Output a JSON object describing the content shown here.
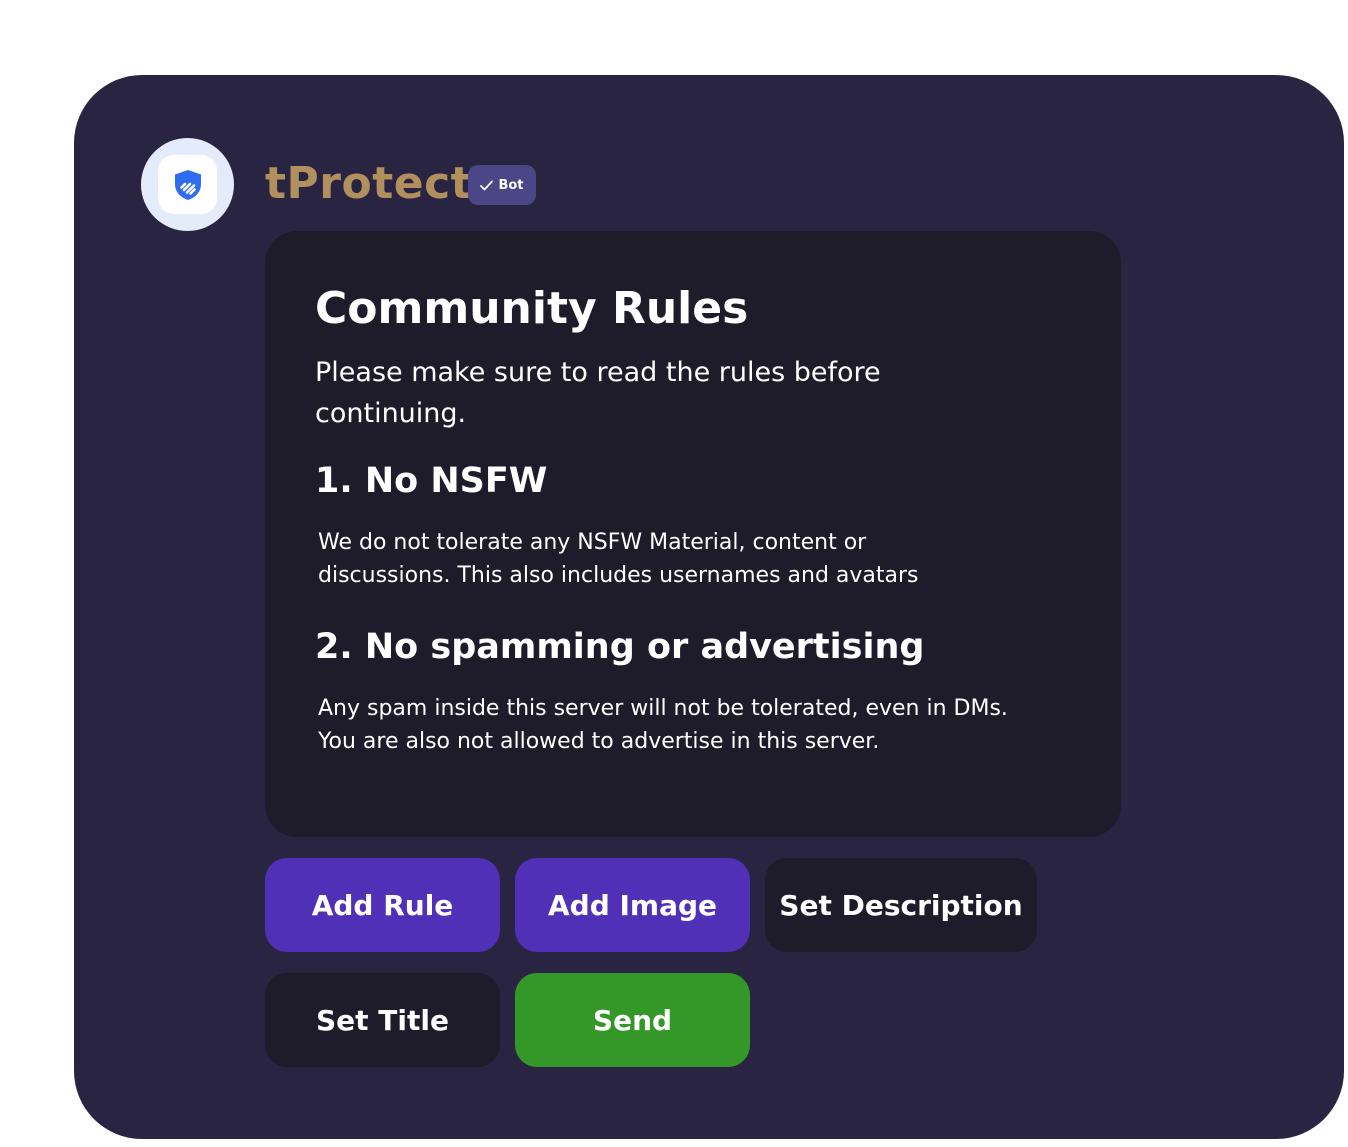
{
  "bot": {
    "username": "tProtect",
    "badge_label": "Bot",
    "avatar_icon": "shield-icon",
    "badge_icon": "checkmark-icon"
  },
  "embed": {
    "title": "Community Rules",
    "description": "Please make sure to read the rules before continuing.",
    "rules": [
      {
        "title": "1. No NSFW",
        "text_lines": [
          "We do not tolerate any NSFW Material, content or",
          "discussions. This also includes usernames and avatars"
        ]
      },
      {
        "title": "2. No spamming or advertising",
        "text_lines": [
          "Any spam inside this server will not be tolerated, even in DMs.",
          "You are also not allowed to advertise in this server."
        ]
      }
    ]
  },
  "buttons": {
    "add_rule": "Add Rule",
    "add_image": "Add Image",
    "set_description": "Set Description",
    "set_title": "Set Title",
    "send": "Send"
  },
  "colors": {
    "panel_background": "#2a2443",
    "embed_background": "#1e1b2a",
    "username": "#b2905e",
    "badge": "#4b4685",
    "primary_button": "#5130b8",
    "dark_button": "#1e1b2a",
    "send_button": "#339828",
    "shield": "#2f6df0"
  }
}
